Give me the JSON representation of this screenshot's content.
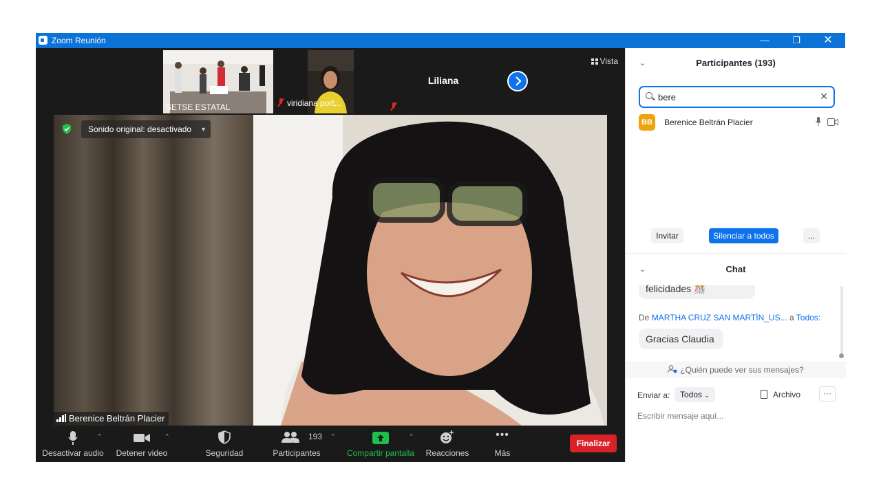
{
  "window": {
    "title": "Zoom Reunión"
  },
  "thumbs": [
    {
      "name": "SETSE ESTATAL",
      "muted": false
    },
    {
      "name": "viridiana port...",
      "muted": true
    },
    {
      "name": "Liliana",
      "muted": true
    }
  ],
  "view_label": "Vista",
  "main": {
    "sound_label": "Sonido original: desactivado",
    "speaker_name": "Berenice Beltrán Placier"
  },
  "toolbar": {
    "audio": "Desactivar audio",
    "video": "Detener video",
    "security": "Seguridad",
    "participants": "Participantes",
    "participants_count": "193",
    "share": "Compartir pantalla",
    "reactions": "Reacciones",
    "more": "Más",
    "end": "Finalizar"
  },
  "participants_panel": {
    "title": "Participantes (193)",
    "search_value": "bere",
    "results": [
      {
        "initials": "BB",
        "name": "Berenice Beltrán Placier"
      }
    ],
    "invite": "Invitar",
    "mute_all": "Silenciar a todos",
    "more": "..."
  },
  "chat_panel": {
    "title": "Chat",
    "messages": [
      {
        "text": "felicidades 🎊"
      },
      {
        "from_prefix": "De",
        "from": "MARTHA CRUZ SAN MARTÌN_US...",
        "to_prefix": "a",
        "to": "Todos:",
        "text": "Gracias Claudia"
      }
    ],
    "who_sees": "¿Quién puede ver sus mensajes?",
    "send_to_label": "Enviar a:",
    "send_to_value": "Todos",
    "file_label": "Archivo",
    "input_placeholder": "Escribir mensaje aquí..."
  },
  "colors": {
    "accent": "#0e72ed",
    "end": "#d92228",
    "share": "#1cc04f",
    "titlebar": "#0b72d8"
  }
}
